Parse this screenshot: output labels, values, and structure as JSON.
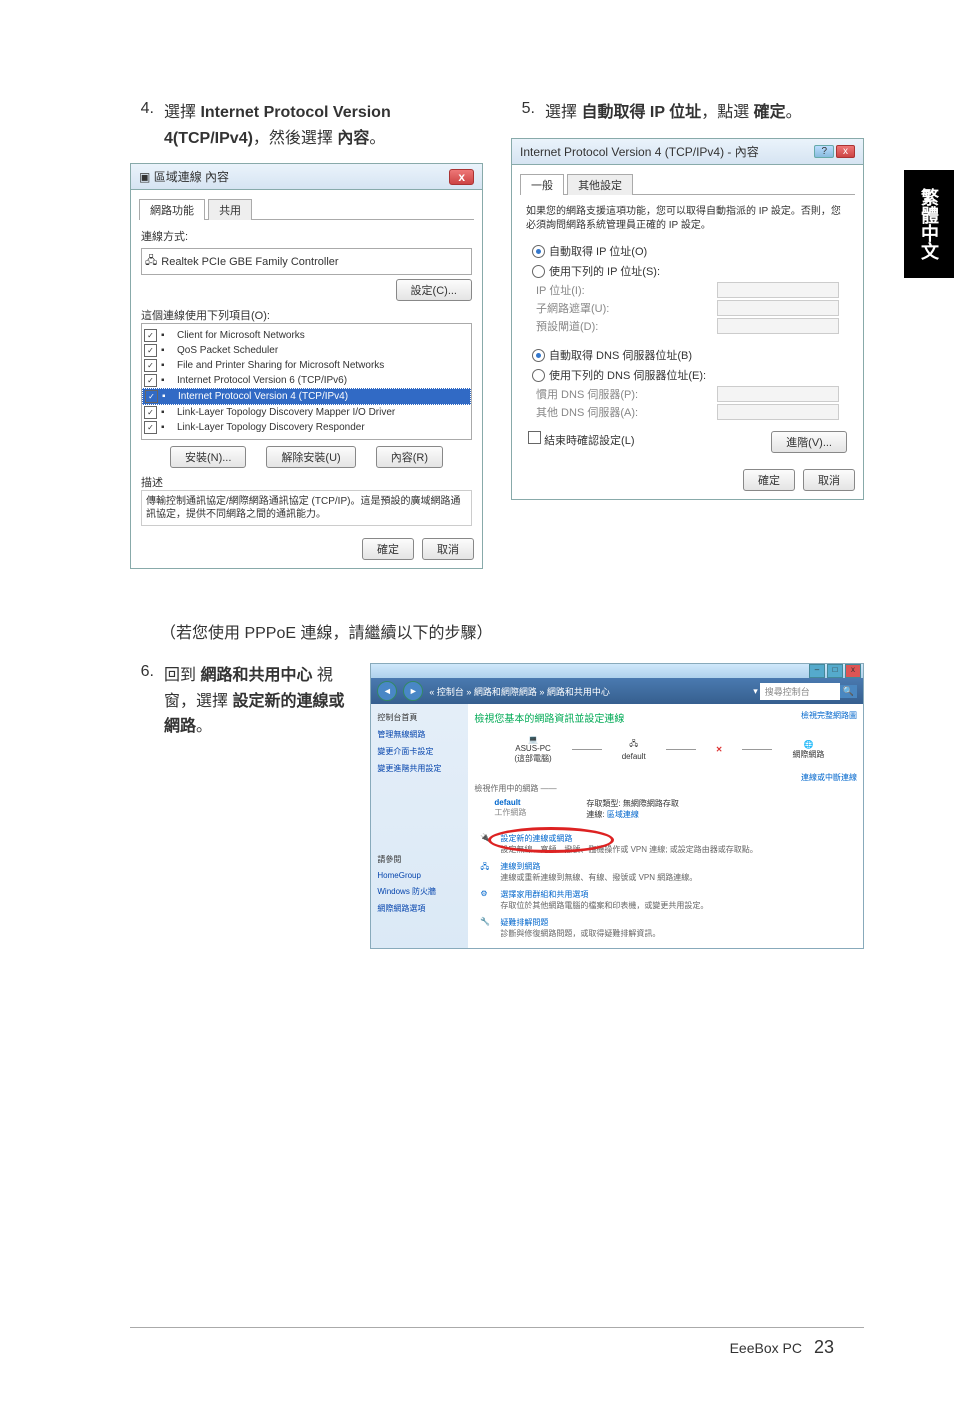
{
  "sidebar_tab": "繁體中文",
  "step4": {
    "num": "4.",
    "prefix": "選擇 ",
    "bold1": "Internet Protocol Version 4(TCP/IPv4)",
    "mid": "，然後選擇 ",
    "bold2": "內容",
    "suffix": "。"
  },
  "step5": {
    "num": "5.",
    "prefix": "選擇 ",
    "bold1": "自動取得 IP 位址",
    "mid": "，點選 ",
    "bold2": "確定",
    "suffix": "。"
  },
  "note": "（若您使用 PPPoE 連線，請繼續以下的步驟）",
  "step6": {
    "num": "6.",
    "prefix": "回到 ",
    "bold1": "網路和共用中心",
    "mid": " 視窗，選擇 ",
    "bold2": "設定新的連線或網路",
    "suffix": "。"
  },
  "win1": {
    "title": "區域連線 內容",
    "close": "x",
    "tab1": "網路功能",
    "tab2": "共用",
    "conn_label": "連線方式:",
    "adapter": "Realtek PCIe GBE Family Controller",
    "config": "設定(C)...",
    "uses_label": "這個連線使用下列項目(O):",
    "items": [
      "Client for Microsoft Networks",
      "QoS Packet Scheduler",
      "File and Printer Sharing for Microsoft Networks",
      "Internet Protocol Version 6 (TCP/IPv6)",
      "Internet Protocol Version 4 (TCP/IPv4)",
      "Link-Layer Topology Discovery Mapper I/O Driver",
      "Link-Layer Topology Discovery Responder"
    ],
    "install": "安裝(N)...",
    "uninstall": "解除安裝(U)",
    "properties": "內容(R)",
    "desc_label": "描述",
    "desc": "傳輸控制通訊協定/網際網路通訊協定 (TCP/IP)。這是預設的廣域網路通訊協定，提供不同網路之間的通訊能力。",
    "ok": "確定",
    "cancel": "取消"
  },
  "win2": {
    "title": "Internet Protocol Version 4 (TCP/IPv4) - 內容",
    "q": "?",
    "close": "x",
    "tab1": "一般",
    "tab2": "其他設定",
    "intro": "如果您的網路支援這項功能，您可以取得自動指派的 IP 設定。否則，您必須詢問網路系統管理員正確的 IP 設定。",
    "r1": "自動取得 IP 位址(O)",
    "r2": "使用下列的 IP 位址(S):",
    "ip_label": "IP 位址(I):",
    "subnet_label": "子網路遮罩(U):",
    "gateway_label": "預設閘道(D):",
    "r3": "自動取得 DNS 伺服器位址(B)",
    "r4": "使用下列的 DNS 伺服器位址(E):",
    "dns1": "慣用 DNS 伺服器(P):",
    "dns2": "其他 DNS 伺服器(A):",
    "exit_chk": "結束時確認設定(L)",
    "advanced": "進階(V)...",
    "ok": "確定",
    "cancel": "取消"
  },
  "sharing": {
    "min": "–",
    "max": "□",
    "close": "x",
    "crumb": "« 控制台 » 網路和網際網路 » 網路和共用中心",
    "search_ph": "搜尋控制台",
    "left_title": "控制台首頁",
    "left_items": [
      "管理無線網路",
      "變更介面卡設定",
      "變更進階共用設定"
    ],
    "left_bottom": [
      "請參閱",
      "HomeGroup",
      "Windows 防火牆",
      "網際網路選項"
    ],
    "pane_title": "檢視您基本的網路資訊並設定連線",
    "map_link": "檢視完整網路圖",
    "pc": "ASUS-PC",
    "pc_sub": "(這部電腦)",
    "net": "default",
    "inet": "網際網路",
    "view_label": "檢視作用中的網路 ——",
    "net_sub": "工作網路",
    "acc_type_l": "存取類型:",
    "acc_type_v": "無網際網路存取",
    "conn_l": "連線:",
    "conn_v": "區域連線",
    "change_link": "連線或中斷連線",
    "opts": [
      {
        "t": "設定新的連線或網路",
        "d": "設定無線、寬頻、撥號、臨機操作或 VPN 連線; 或設定路由器或存取點。"
      },
      {
        "t": "連線到網路",
        "d": "連線或重新連線到無線、有線、撥號或 VPN 網路連線。"
      },
      {
        "t": "選擇家用群組和共用選項",
        "d": "存取位於其他網路電腦的檔案和印表機，或變更共用設定。"
      },
      {
        "t": "疑難排解問題",
        "d": "診斷與修復網路問題，或取得疑難排解資訊。"
      }
    ]
  },
  "footer": {
    "name": "EeeBox PC",
    "page": "23"
  }
}
